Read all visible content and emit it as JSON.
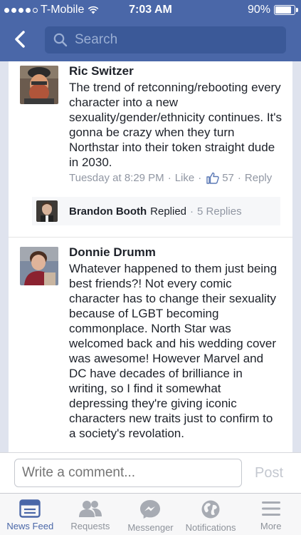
{
  "status_bar": {
    "carrier": "T-Mobile",
    "time": "7:03 AM",
    "battery": "90%",
    "battery_level": 0.9
  },
  "header": {
    "back_icon": "chevron-left-icon",
    "search_placeholder": "Search"
  },
  "comments": [
    {
      "author": "Ric Switzer",
      "text": "The trend of retconning/rebooting every character into a new sexuality/gender/ethnicity continues. It's gonna be crazy when they turn Northstar into their token straight dude in 2030.",
      "time": "Tuesday at 8:29 PM",
      "like_label": "Like",
      "like_count": "57",
      "reply_label": "Reply"
    },
    {
      "author": "Donnie Drumm",
      "text": "Whatever happened to them just being best friends?! Not every comic character has to change their sexuality because of LGBT becoming commonplace.  North Star was welcomed back and his wedding cover was awesome! However Marvel and DC have decades of brilliance in writing, so I find it somewhat depressing they're giving iconic characters new traits just to confirm to a society's revolation."
    }
  ],
  "reply_summary": {
    "name": "Brandon Booth",
    "action": "Replied",
    "count": "5 Replies"
  },
  "composer": {
    "placeholder": "Write a comment...",
    "post_label": "Post"
  },
  "tabs": [
    {
      "label": "News Feed",
      "icon": "news-feed-icon",
      "active": true
    },
    {
      "label": "Requests",
      "icon": "requests-icon",
      "active": false
    },
    {
      "label": "Messenger",
      "icon": "messenger-icon",
      "active": false
    },
    {
      "label": "Notifications",
      "icon": "notifications-icon",
      "active": false
    },
    {
      "label": "More",
      "icon": "more-icon",
      "active": false
    }
  ],
  "colors": {
    "brand": "#4a67a8",
    "search_bg": "#3b5998",
    "meta_text": "#9197a3"
  }
}
